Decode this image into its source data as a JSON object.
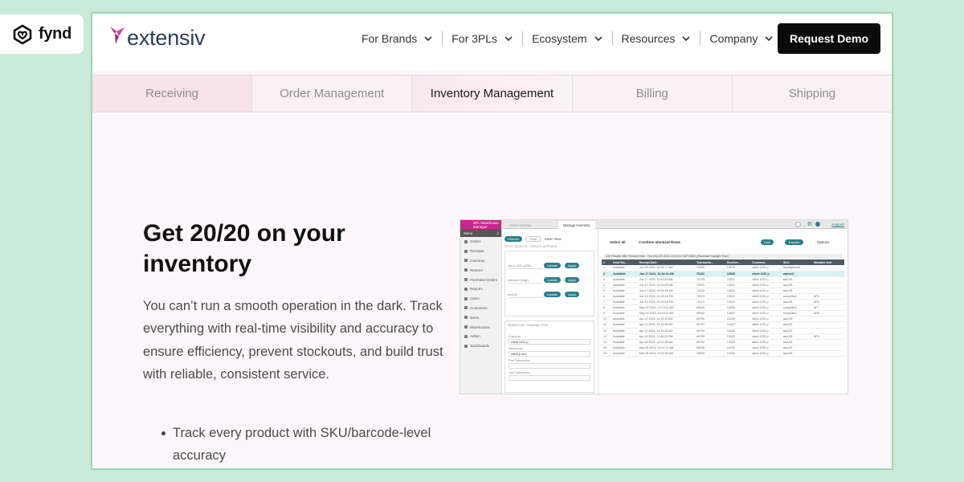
{
  "badge": {
    "brand": "fynd"
  },
  "nav": {
    "logo_text": "extensiv",
    "menu": [
      {
        "label": "For Brands"
      },
      {
        "label": "For 3PLs"
      },
      {
        "label": "Ecosystem"
      },
      {
        "label": "Resources"
      },
      {
        "label": "Company"
      }
    ],
    "cta_label": "Request Demo"
  },
  "tabs": [
    {
      "label": "Receiving",
      "active": false
    },
    {
      "label": "Order Management",
      "active": false
    },
    {
      "label": "Inventory Management",
      "active": true
    },
    {
      "label": "Billing",
      "active": false
    },
    {
      "label": "Shipping",
      "active": false
    }
  ],
  "hero": {
    "title": "Get 20/20 on your inventory",
    "body": "You can’t run a smooth operation in the dark. Track everything with real-time visibility and accuracy to ensure efficiency, prevent stockouts, and build trust with reliable, consistent service.",
    "bullets": [
      "Track every product with SKU/barcode-level accuracy"
    ]
  },
  "screenshot": {
    "brand": "3PL Warehouse Manager",
    "menu_label": "Menu",
    "sidebar": [
      "Orders",
      "Receipts",
      "Inventory",
      "Returns",
      "Purchase Orders",
      "Reports",
      "Users",
      "Customers",
      "Items",
      "Warehouses",
      "Admin",
      "Dashboards"
    ],
    "tabs": [
      "Find Inventory",
      "Manage Inventory"
    ],
    "support": "Support",
    "buttons": {
      "refresh": "Refresh",
      "clear": "Clear",
      "save_view": "Save View",
      "update": "Update",
      "apply": "Apply",
      "hold": "Hold",
      "transfer": "Transfer",
      "options": "Options"
    },
    "select_all": "Select all",
    "combine": "Combine Identical Rows",
    "results_text": "100 Results With Receipt Date : Thu Sep 05 2024 22:00:00 GMT-0600 (Mountain Daylight Time)",
    "note": "NOTE: SEARCH / CREATE APPEARS",
    "columns": [
      "#",
      "Hold Sta...",
      "Receipt Date",
      "Transactio...",
      "Receive...",
      "Customer",
      "SKU",
      "Movable Unit"
    ],
    "rows": [
      [
        "1",
        "Available",
        "Jun 20 2024, 11:26:17 AM",
        "73020",
        "13576",
        "client 1031 p",
        "headlightsmtl",
        ""
      ],
      [
        "2",
        "Available",
        "Jun 17 2024, 11:44:14 AM",
        "70132",
        "13528",
        "client 1031 p",
        "raptor@",
        ""
      ],
      [
        "3",
        "Available",
        "Jun 17 2024, 10:43:00 AM",
        "72135",
        "13521",
        "client 1031 p",
        "skuUSt",
        ""
      ],
      [
        "4",
        "Available",
        "Jun 17 2024, 10:03:00 AM",
        "72031",
        "13521",
        "client 1031 p",
        "skuUSt",
        ""
      ],
      [
        "5",
        "Available",
        "Jun 17 2024, 09:16:26 AM",
        "72026",
        "13521",
        "client 1031 p",
        "skuUSt",
        ""
      ],
      [
        "6",
        "Available",
        "Jun 13 2024, 01:40:18 PM",
        "70113",
        "13531",
        "client 1031 p",
        "comp2Bu2",
        "AF6"
      ],
      [
        "7",
        "Available",
        "Jun 13 2024, 01:40:08 PM",
        "70113",
        "13532",
        "client 1031 p",
        "skuUSt",
        "AF6"
      ],
      [
        "8",
        "Available",
        "May 02 2024, 12:19:11 AM",
        "69949",
        "13506",
        "client 1031 p",
        "comp2Bu1",
        "AF7"
      ],
      [
        "9",
        "Available",
        "May 02 2024, 12:19:11 AM",
        "69940",
        "13507",
        "client 1031 p",
        "comp2Bu1",
        "AF6"
      ],
      [
        "10",
        "Available",
        "Apr 13 2024, 12:15:00 AM",
        "69795",
        "13429",
        "client 1031 p",
        "skuUSt",
        ""
      ],
      [
        "11",
        "Available",
        "Apr 13 2024, 12:14:56 AM",
        "69797",
        "13427",
        "client 1031 p",
        "skuUSt",
        ""
      ],
      [
        "12",
        "Available",
        "Apr 13 2024, 12:12:08 AM",
        "69794",
        "13426",
        "client 1031 p",
        "skuUSt",
        ""
      ],
      [
        "13",
        "Available",
        "Apr 10 2024, 11:48:23 PM",
        "69795",
        "13425",
        "client 1031 p",
        "skuUSt",
        "AF5"
      ],
      [
        "14",
        "Available",
        "Apr 06 2024, 12:01:08 AM",
        "69792",
        "13309",
        "client 1031 p",
        "skuUSt",
        ""
      ],
      [
        "15",
        "Available",
        "Mar 28 2024, 12:19:12 AM",
        "69996",
        "13202",
        "client 1031 p",
        "skuUSt",
        ""
      ],
      [
        "16",
        "Available",
        "Mar 28 2024, 12:22:00 AM",
        "69990",
        "13202",
        "client 1031 p",
        "skuUSt",
        ""
      ]
    ],
    "filters": [
      "client 1031 (p/Zx)",
      "standard (hdgt)",
      "skuUSt"
    ],
    "form_header": "SEARCH BY TRANSACTION",
    "customer_label": "Customer",
    "customer_value": "client 1031 p",
    "warehouse_label": "Warehouse",
    "warehouse_value": "client p wh1",
    "first_trans_label": "First Transaction",
    "last_trans_label": "Last Transaction"
  }
}
